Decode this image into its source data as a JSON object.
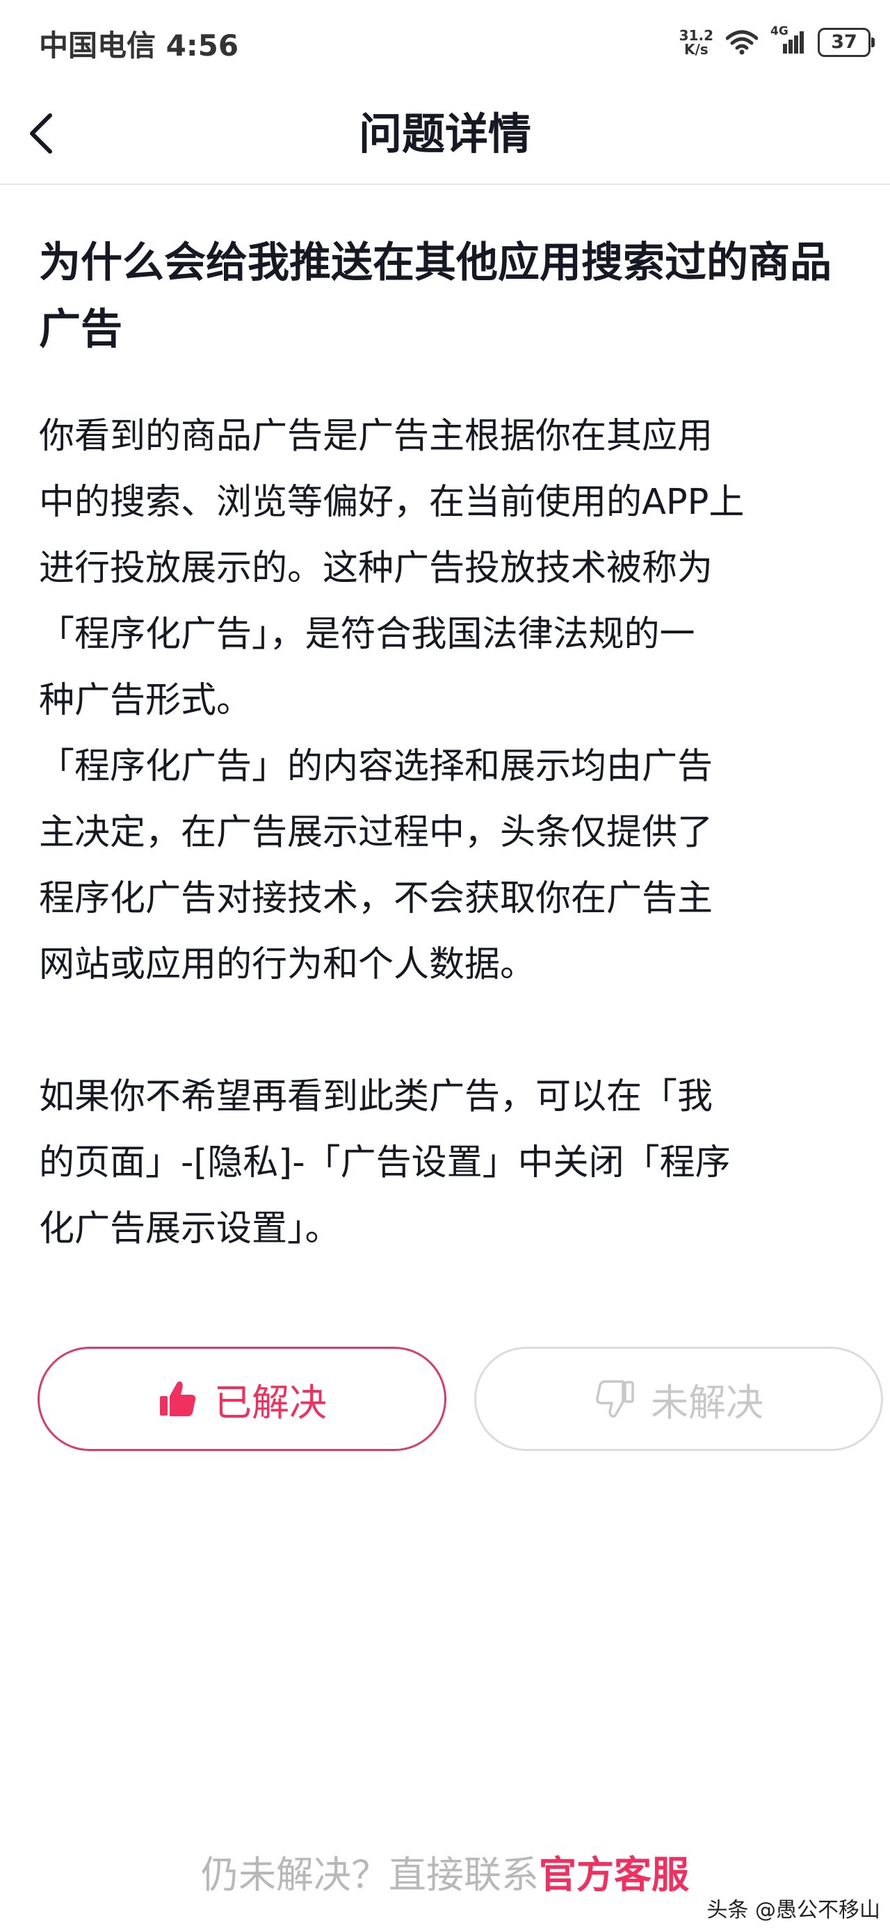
{
  "status_bar": {
    "carrier": "中国电信",
    "time": "4:56",
    "speed_value": "31.2",
    "speed_unit": "K/s",
    "network": "4G",
    "battery": "37"
  },
  "nav": {
    "back_icon": "chevron-left-icon",
    "title": "问题详情"
  },
  "question": {
    "title": "为什么会给我推送在其他应用搜索过的商品广告"
  },
  "answer": {
    "paragraph_1": "你看到的商品广告是广告主根据你在其应用\n中的搜索、浏览等偏好，在当前使用的APP上\n进行投放展示的。这种广告投放技术被称为\n「程序化广告」，是符合我国法律法规的一\n种广告形式。",
    "paragraph_2": "「程序化广告」的内容选择和展示均由广告\n主决定，在广告展示过程中，头条仅提供了\n程序化广告对接技术，不会获取你在广告主\n网站或应用的行为和个人数据。",
    "paragraph_3": "如果你不希望再看到此类广告，可以在「我\n的页面」-[隐私]-「广告设置」中关闭「程序\n化广告展示设置」。"
  },
  "feedback": {
    "solved_label": "已解决",
    "solved_icon": "thumbs-up-icon",
    "unsolved_label": "未解决",
    "unsolved_icon": "thumbs-down-icon"
  },
  "footer": {
    "prompt": "仍未解决？直接联系",
    "link_label": "官方客服",
    "watermark": "头条 @愚公不移山"
  },
  "colors": {
    "accent": "#f0305f",
    "text": "#161823",
    "muted": "#b8b8b8"
  }
}
